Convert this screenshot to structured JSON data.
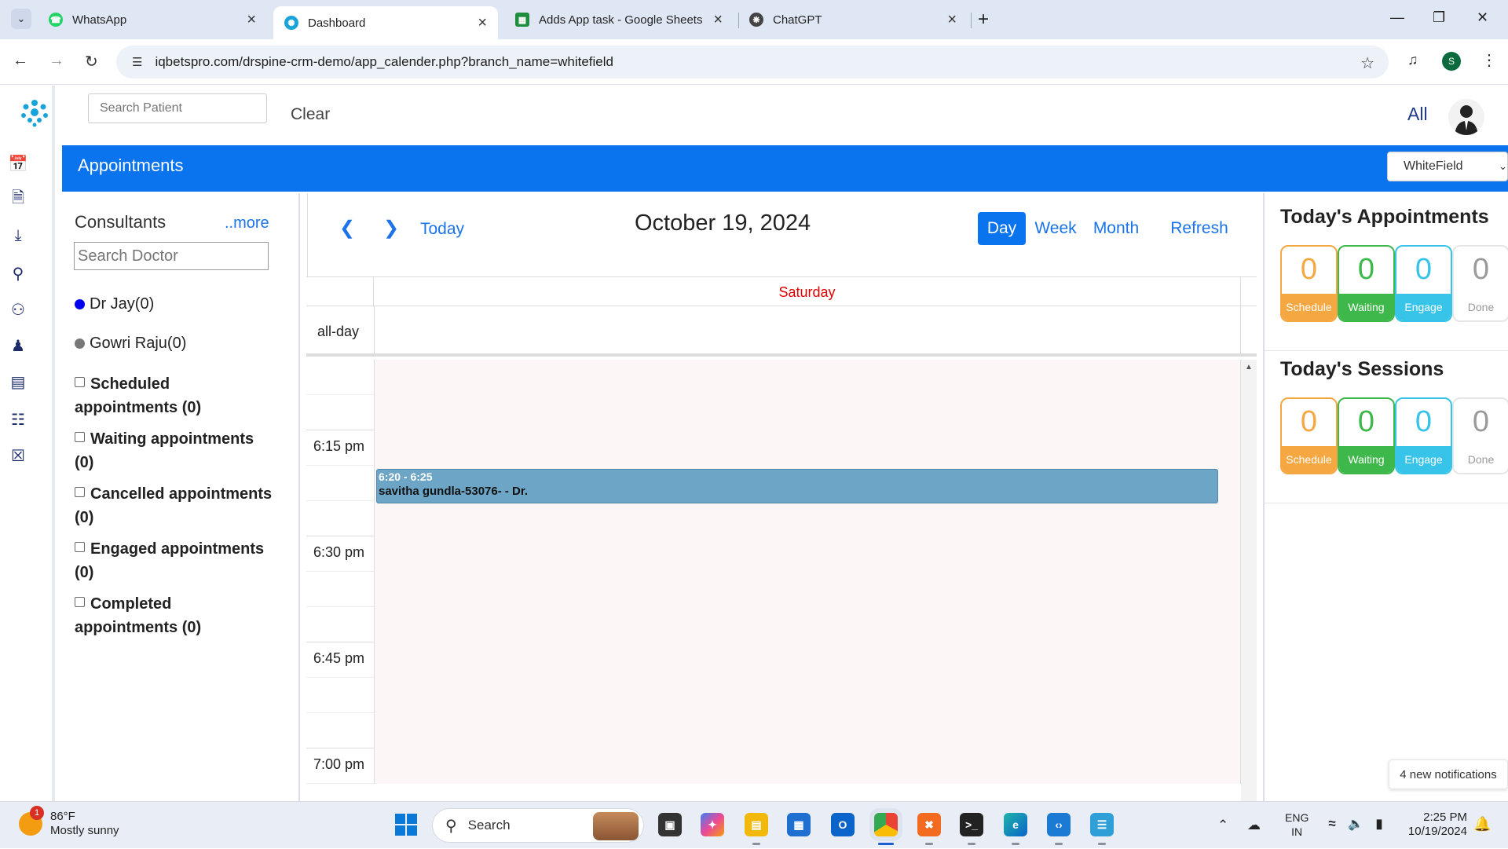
{
  "browser": {
    "tabs": [
      {
        "title": "WhatsApp",
        "icon": "whatsapp-icon",
        "color": "#25d366"
      },
      {
        "title": "Dashboard",
        "icon": "drspine-icon",
        "color": "#1aa3d9",
        "active": true
      },
      {
        "title": "Adds App task - Google Sheets",
        "icon": "sheets-icon",
        "color": "#1e8e3e"
      },
      {
        "title": "ChatGPT",
        "icon": "chatgpt-icon",
        "color": "#444444"
      }
    ],
    "url": "iqbetspro.com/drspine-crm-demo/app_calender.php?branch_name=whitefield",
    "profile_initial": "S"
  },
  "header": {
    "search_placeholder": "Search Patient",
    "clear_label": "Clear",
    "filter_label": "All"
  },
  "banner": {
    "title": "Appointments",
    "branch": "WhiteField"
  },
  "consultants": {
    "title": "Consultants",
    "more_label": "..more",
    "search_placeholder": "Search Doctor",
    "doctors": [
      {
        "name": "Dr Jay(0)",
        "color": "#0000ee"
      },
      {
        "name": "Gowri Raju(0)",
        "color": "#777777"
      }
    ],
    "filters": [
      {
        "label": "Scheduled appointments",
        "count": "(0)"
      },
      {
        "label": "Waiting appointments",
        "count": "(0)"
      },
      {
        "label": "Cancelled appointments",
        "count": "(0)"
      },
      {
        "label": "Engaged appointments",
        "count": "(0)"
      },
      {
        "label": "Completed appointments",
        "count": "(0)"
      }
    ]
  },
  "calendar": {
    "today_label": "Today",
    "title": "October 19, 2024",
    "views": [
      "Day",
      "Week",
      "Month"
    ],
    "selected_view": "Day",
    "refresh_label": "Refresh",
    "day_name": "Saturday",
    "allday_label": "all-day",
    "time_labels": [
      "6:15 pm",
      "6:30 pm",
      "6:45 pm",
      "7:00 pm"
    ],
    "event": {
      "time": "6:20 - 6:25",
      "title": "savitha gundla-53076- - Dr.",
      "color": "#6ca5c6"
    }
  },
  "today_appointments": {
    "title": "Today's Appointments",
    "stats": [
      {
        "value": "0",
        "label": "Schedule"
      },
      {
        "value": "0",
        "label": "Waiting"
      },
      {
        "value": "0",
        "label": "Engage"
      },
      {
        "value": "0",
        "label": "Done"
      }
    ]
  },
  "today_sessions": {
    "title": "Today's Sessions",
    "stats": [
      {
        "value": "0",
        "label": "Schedule"
      },
      {
        "value": "0",
        "label": "Waiting"
      },
      {
        "value": "0",
        "label": "Engage"
      },
      {
        "value": "0",
        "label": "Done"
      }
    ]
  },
  "notifications": {
    "label": "4 new notifications"
  },
  "taskbar": {
    "weather_temp": "86°F",
    "weather_desc": "Mostly sunny",
    "weather_badge": "1",
    "search_label": "Search",
    "lang_line1": "ENG",
    "lang_line2": "IN",
    "time": "2:25 PM",
    "date": "10/19/2024"
  }
}
